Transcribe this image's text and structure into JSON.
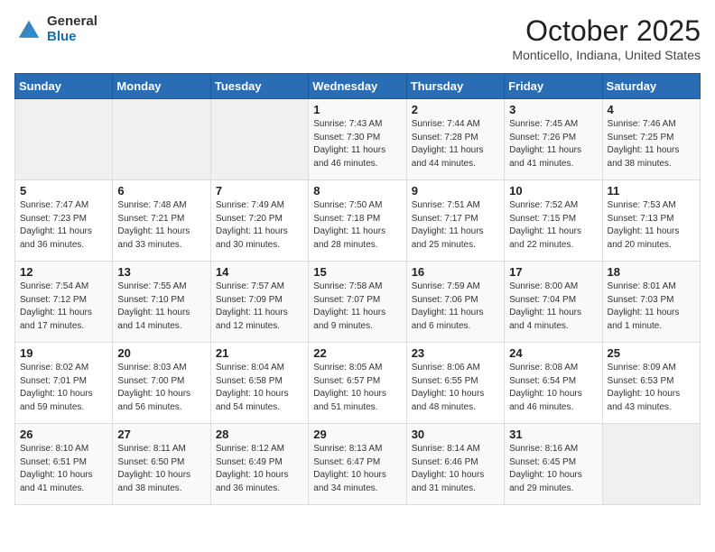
{
  "header": {
    "logo_general": "General",
    "logo_blue": "Blue",
    "month_title": "October 2025",
    "location": "Monticello, Indiana, United States"
  },
  "calendar": {
    "days_of_week": [
      "Sunday",
      "Monday",
      "Tuesday",
      "Wednesday",
      "Thursday",
      "Friday",
      "Saturday"
    ],
    "weeks": [
      [
        {
          "day": "",
          "info": ""
        },
        {
          "day": "",
          "info": ""
        },
        {
          "day": "",
          "info": ""
        },
        {
          "day": "1",
          "info": "Sunrise: 7:43 AM\nSunset: 7:30 PM\nDaylight: 11 hours\nand 46 minutes."
        },
        {
          "day": "2",
          "info": "Sunrise: 7:44 AM\nSunset: 7:28 PM\nDaylight: 11 hours\nand 44 minutes."
        },
        {
          "day": "3",
          "info": "Sunrise: 7:45 AM\nSunset: 7:26 PM\nDaylight: 11 hours\nand 41 minutes."
        },
        {
          "day": "4",
          "info": "Sunrise: 7:46 AM\nSunset: 7:25 PM\nDaylight: 11 hours\nand 38 minutes."
        }
      ],
      [
        {
          "day": "5",
          "info": "Sunrise: 7:47 AM\nSunset: 7:23 PM\nDaylight: 11 hours\nand 36 minutes."
        },
        {
          "day": "6",
          "info": "Sunrise: 7:48 AM\nSunset: 7:21 PM\nDaylight: 11 hours\nand 33 minutes."
        },
        {
          "day": "7",
          "info": "Sunrise: 7:49 AM\nSunset: 7:20 PM\nDaylight: 11 hours\nand 30 minutes."
        },
        {
          "day": "8",
          "info": "Sunrise: 7:50 AM\nSunset: 7:18 PM\nDaylight: 11 hours\nand 28 minutes."
        },
        {
          "day": "9",
          "info": "Sunrise: 7:51 AM\nSunset: 7:17 PM\nDaylight: 11 hours\nand 25 minutes."
        },
        {
          "day": "10",
          "info": "Sunrise: 7:52 AM\nSunset: 7:15 PM\nDaylight: 11 hours\nand 22 minutes."
        },
        {
          "day": "11",
          "info": "Sunrise: 7:53 AM\nSunset: 7:13 PM\nDaylight: 11 hours\nand 20 minutes."
        }
      ],
      [
        {
          "day": "12",
          "info": "Sunrise: 7:54 AM\nSunset: 7:12 PM\nDaylight: 11 hours\nand 17 minutes."
        },
        {
          "day": "13",
          "info": "Sunrise: 7:55 AM\nSunset: 7:10 PM\nDaylight: 11 hours\nand 14 minutes."
        },
        {
          "day": "14",
          "info": "Sunrise: 7:57 AM\nSunset: 7:09 PM\nDaylight: 11 hours\nand 12 minutes."
        },
        {
          "day": "15",
          "info": "Sunrise: 7:58 AM\nSunset: 7:07 PM\nDaylight: 11 hours\nand 9 minutes."
        },
        {
          "day": "16",
          "info": "Sunrise: 7:59 AM\nSunset: 7:06 PM\nDaylight: 11 hours\nand 6 minutes."
        },
        {
          "day": "17",
          "info": "Sunrise: 8:00 AM\nSunset: 7:04 PM\nDaylight: 11 hours\nand 4 minutes."
        },
        {
          "day": "18",
          "info": "Sunrise: 8:01 AM\nSunset: 7:03 PM\nDaylight: 11 hours\nand 1 minute."
        }
      ],
      [
        {
          "day": "19",
          "info": "Sunrise: 8:02 AM\nSunset: 7:01 PM\nDaylight: 10 hours\nand 59 minutes."
        },
        {
          "day": "20",
          "info": "Sunrise: 8:03 AM\nSunset: 7:00 PM\nDaylight: 10 hours\nand 56 minutes."
        },
        {
          "day": "21",
          "info": "Sunrise: 8:04 AM\nSunset: 6:58 PM\nDaylight: 10 hours\nand 54 minutes."
        },
        {
          "day": "22",
          "info": "Sunrise: 8:05 AM\nSunset: 6:57 PM\nDaylight: 10 hours\nand 51 minutes."
        },
        {
          "day": "23",
          "info": "Sunrise: 8:06 AM\nSunset: 6:55 PM\nDaylight: 10 hours\nand 48 minutes."
        },
        {
          "day": "24",
          "info": "Sunrise: 8:08 AM\nSunset: 6:54 PM\nDaylight: 10 hours\nand 46 minutes."
        },
        {
          "day": "25",
          "info": "Sunrise: 8:09 AM\nSunset: 6:53 PM\nDaylight: 10 hours\nand 43 minutes."
        }
      ],
      [
        {
          "day": "26",
          "info": "Sunrise: 8:10 AM\nSunset: 6:51 PM\nDaylight: 10 hours\nand 41 minutes."
        },
        {
          "day": "27",
          "info": "Sunrise: 8:11 AM\nSunset: 6:50 PM\nDaylight: 10 hours\nand 38 minutes."
        },
        {
          "day": "28",
          "info": "Sunrise: 8:12 AM\nSunset: 6:49 PM\nDaylight: 10 hours\nand 36 minutes."
        },
        {
          "day": "29",
          "info": "Sunrise: 8:13 AM\nSunset: 6:47 PM\nDaylight: 10 hours\nand 34 minutes."
        },
        {
          "day": "30",
          "info": "Sunrise: 8:14 AM\nSunset: 6:46 PM\nDaylight: 10 hours\nand 31 minutes."
        },
        {
          "day": "31",
          "info": "Sunrise: 8:16 AM\nSunset: 6:45 PM\nDaylight: 10 hours\nand 29 minutes."
        },
        {
          "day": "",
          "info": ""
        }
      ]
    ]
  }
}
